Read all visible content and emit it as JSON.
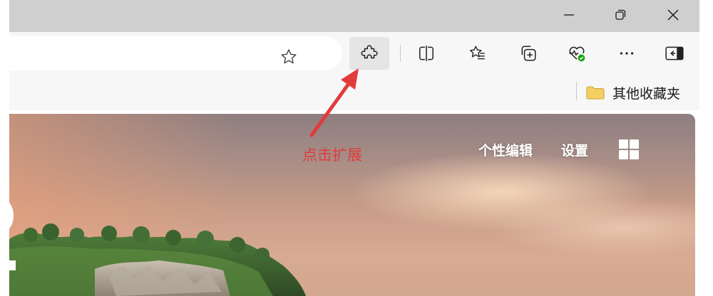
{
  "window_controls": {
    "minimize_icon": "minimize-icon",
    "restore_icon": "restore-icon",
    "close_icon": "close-icon"
  },
  "toolbar": {
    "favorite_icon": "star-icon",
    "buttons": [
      "extensions-icon",
      "split-screen-icon",
      "favorites-icon",
      "collections-icon",
      "browser-essentials-icon",
      "more-icon",
      "sidebar-icon"
    ]
  },
  "favorites_bar": {
    "folder_icon": "folder-icon",
    "other_favorites_label": "其他收藏夹"
  },
  "newtab": {
    "personalize_label": "个性编辑",
    "settings_label": "设置",
    "apps_icon": "apps-grid-icon"
  },
  "annotation": {
    "text": "点击扩展",
    "color": "#e23b3b"
  },
  "colors": {
    "titlebar": "#cfcfcf",
    "toolbar": "#f7f7f7",
    "active_button": "#e5e5e5",
    "folder": "#f4d064",
    "health_badge": "#13a10e"
  }
}
